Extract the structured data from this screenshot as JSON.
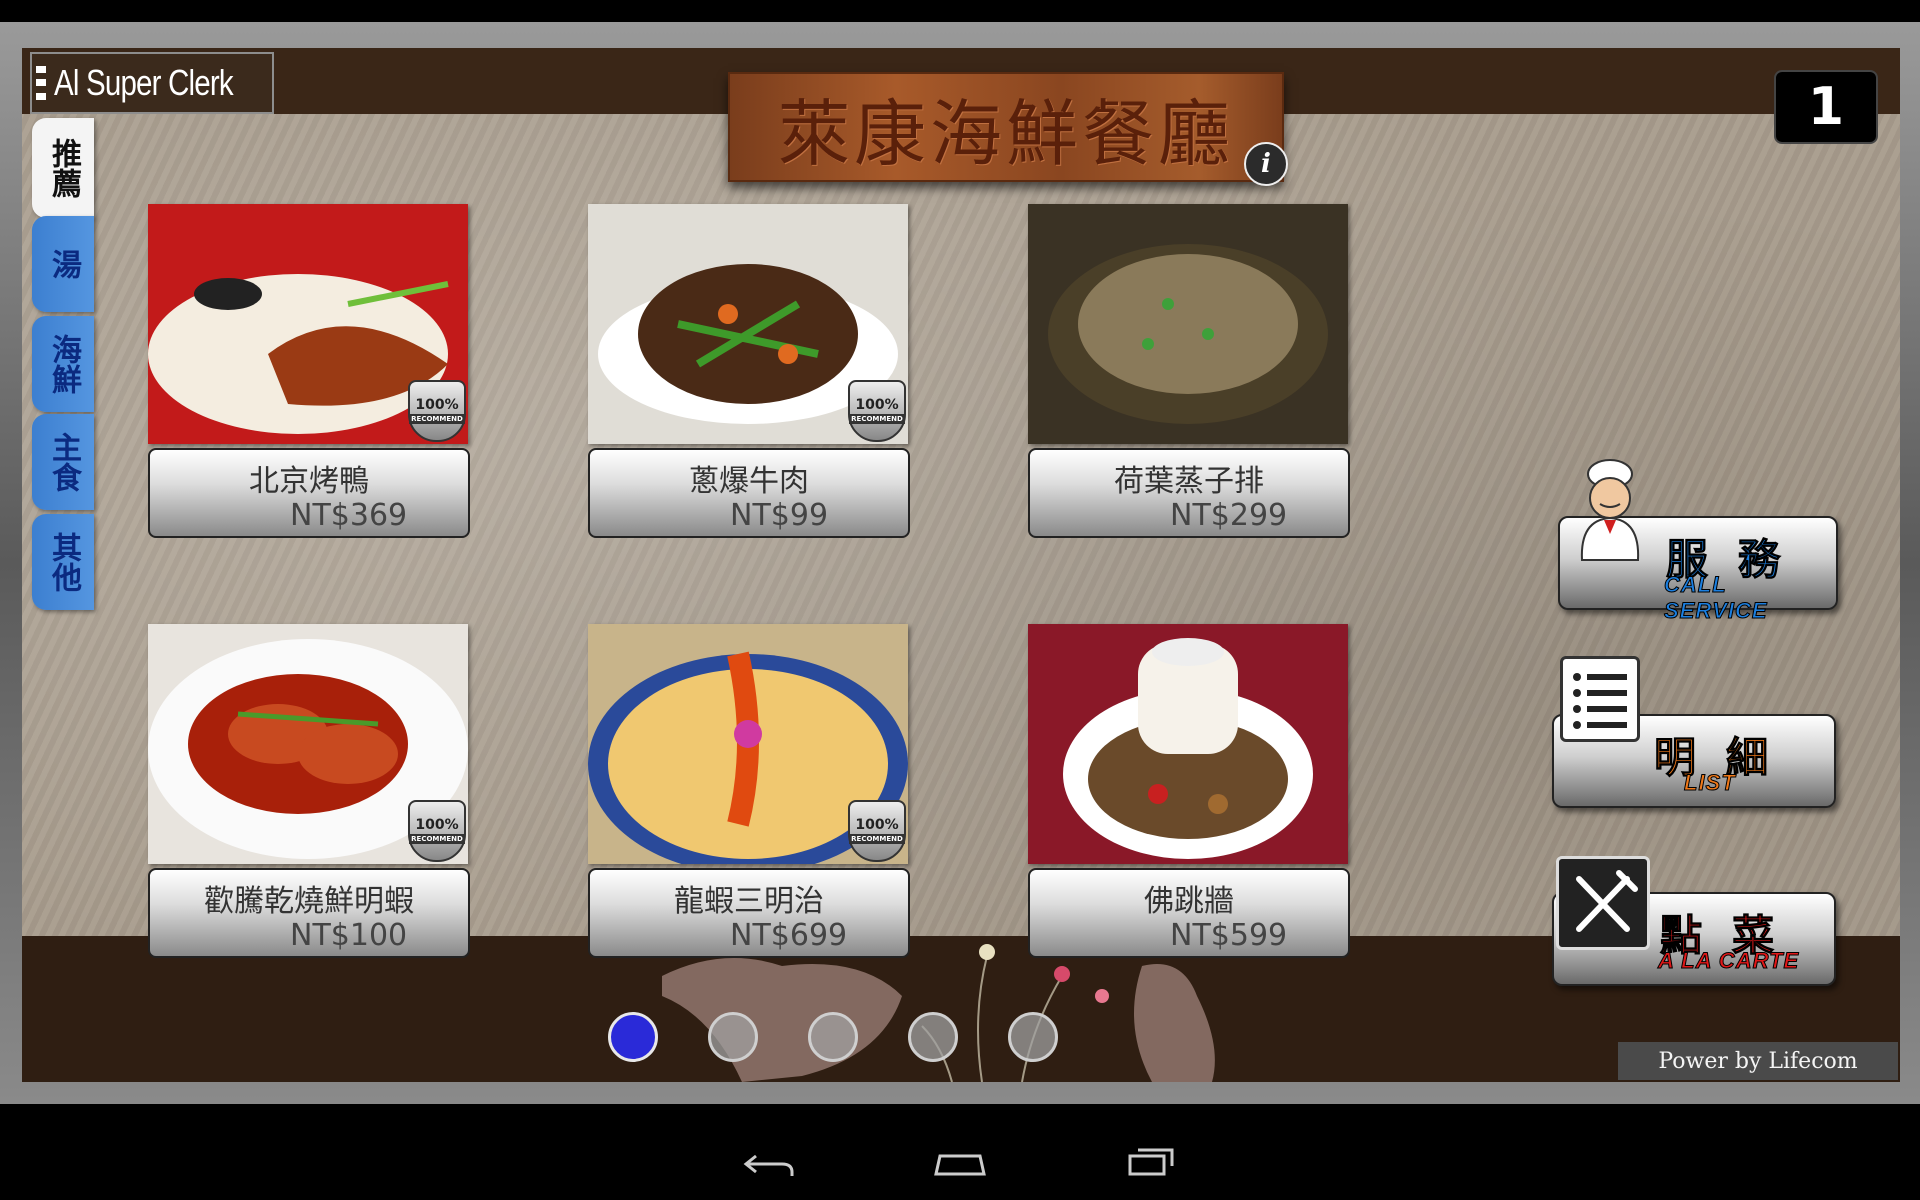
{
  "app": {
    "title": "Al Super Clerk",
    "restaurant_name": "萊康海鮮餐廳",
    "table_number": "1",
    "powered_by": "Power by Lifecom"
  },
  "categories": [
    {
      "label": "推薦",
      "active": true
    },
    {
      "label": "湯",
      "active": false
    },
    {
      "label": "海鮮",
      "active": false
    },
    {
      "label": "主食",
      "active": false
    },
    {
      "label": "其他",
      "active": false
    }
  ],
  "dishes": [
    {
      "name": "北京烤鴨",
      "price": "NT$369",
      "recommended": true,
      "photo": "peking-duck-photo"
    },
    {
      "name": "蔥爆牛肉",
      "price": "NT$99",
      "recommended": true,
      "photo": "scallion-beef-photo"
    },
    {
      "name": "荷葉蒸子排",
      "price": "NT$299",
      "recommended": false,
      "photo": "lotus-leaf-ribs-photo"
    },
    {
      "name": "歡騰乾燒鮮明蝦",
      "price": "NT$100",
      "recommended": true,
      "photo": "dry-braised-prawn-photo"
    },
    {
      "name": "龍蝦三明治",
      "price": "NT$699",
      "recommended": true,
      "photo": "lobster-sandwich-photo"
    },
    {
      "name": "佛跳牆",
      "price": "NT$599",
      "recommended": false,
      "photo": "buddha-jumps-wall-photo"
    }
  ],
  "badge": {
    "percent": "100%",
    "text": "RECOMMEND"
  },
  "actions": {
    "service": {
      "zh": "服務",
      "en": "CALL SERVICE",
      "zh_color": "#1b7fe0",
      "en_color": "#1b7fe0"
    },
    "list": {
      "zh": "明細",
      "en": "LIST",
      "zh_color": "#f07818",
      "en_color": "#f07818"
    },
    "order": {
      "zh": "點菜",
      "en": "A LA CARTE",
      "zh_color": "#e01818",
      "en_color": "#e01818"
    }
  },
  "pager": {
    "pages": 5,
    "current": 1,
    "active_color": "#2a2ad8"
  },
  "info_icon": "i"
}
